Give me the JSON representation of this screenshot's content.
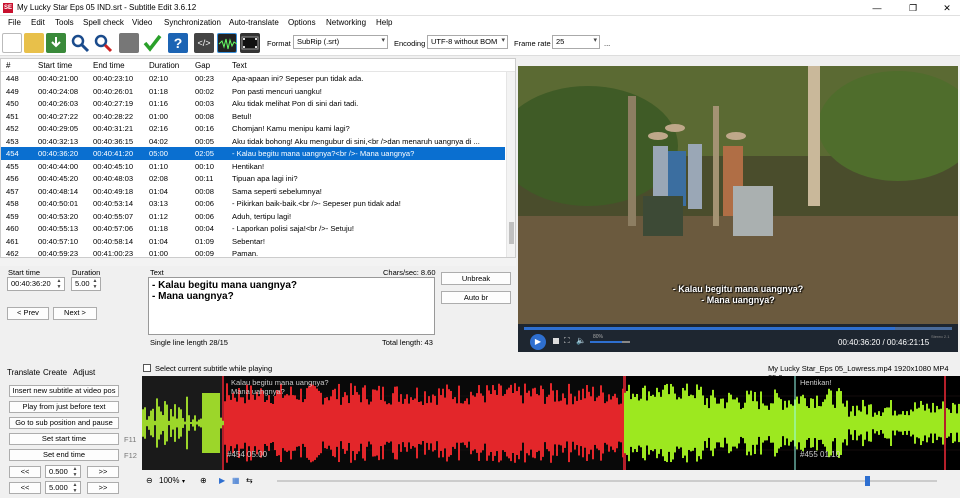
{
  "window": {
    "title": "My Lucky Star Eps 05 IND.srt - Subtitle Edit 3.6.12",
    "app_icon_text": "SE",
    "minimize": "—",
    "maximize": "❐",
    "close": "✕"
  },
  "menu": [
    "File",
    "Edit",
    "Tools",
    "Spell check",
    "Video",
    "Synchronization",
    "Auto-translate",
    "Options",
    "Networking",
    "Help"
  ],
  "toolbar": {
    "format_label": "Format",
    "format_value": "SubRip (.srt)",
    "encoding_label": "Encoding",
    "encoding_value": "UTF-8 without BOM",
    "framerate_label": "Frame rate",
    "framerate_value": "25",
    "more": "..."
  },
  "table": {
    "columns": [
      "#",
      "Start time",
      "End time",
      "Duration",
      "Gap",
      "Text"
    ],
    "rows": [
      [
        "448",
        "00:40:21:00",
        "00:40:23:10",
        "02:10",
        "00:23",
        "Apa-apaan ini? Sepeser pun tidak ada."
      ],
      [
        "449",
        "00:40:24:08",
        "00:40:26:01",
        "01:18",
        "00:02",
        "Pon pasti mencuri uangku!"
      ],
      [
        "450",
        "00:40:26:03",
        "00:40:27:19",
        "01:16",
        "00:03",
        "Aku tidak melihat Pon di sini dari tadi."
      ],
      [
        "451",
        "00:40:27:22",
        "00:40:28:22",
        "01:00",
        "00:08",
        "Betul!"
      ],
      [
        "452",
        "00:40:29:05",
        "00:40:31:21",
        "02:16",
        "00:16",
        "Chomjan! Kamu menipu kami lagi?"
      ],
      [
        "453",
        "00:40:32:13",
        "00:40:36:15",
        "04:02",
        "00:05",
        "Aku tidak bohong! Aku mengubur di sini,<br />dan menaruh uangnya di ..."
      ],
      [
        "454",
        "00:40:36:20",
        "00:40:41:20",
        "05:00",
        "02:05",
        "- Kalau begitu mana uangnya?<br />- Mana uangnya?"
      ],
      [
        "455",
        "00:40:44:00",
        "00:40:45:10",
        "01:10",
        "00:10",
        "Hentikan!"
      ],
      [
        "456",
        "00:40:45:20",
        "00:40:48:03",
        "02:08",
        "00:11",
        "Tipuan apa lagi ini?"
      ],
      [
        "457",
        "00:40:48:14",
        "00:40:49:18",
        "01:04",
        "00:08",
        "Sama seperti sebelumnya!"
      ],
      [
        "458",
        "00:40:50:01",
        "00:40:53:14",
        "03:13",
        "00:06",
        "- Pikirkan baik-baik.<br />- Sepeser pun tidak ada!"
      ],
      [
        "459",
        "00:40:53:20",
        "00:40:55:07",
        "01:12",
        "00:06",
        "Aduh, tertipu lagi!"
      ],
      [
        "460",
        "00:40:55:13",
        "00:40:57:06",
        "01:18",
        "00:04",
        "- Laporkan polisi saja!<br />- Setuju!"
      ],
      [
        "461",
        "00:40:57:10",
        "00:40:58:14",
        "01:04",
        "01:09",
        "Sebentar!"
      ],
      [
        "462",
        "00:40:59:23",
        "00:41:00:23",
        "01:00",
        "00:09",
        "Paman."
      ]
    ]
  },
  "editor": {
    "start_label": "Start time",
    "start_value": "00:40:36:20",
    "duration_label": "Duration",
    "duration_value": "5.00",
    "text_label": "Text",
    "chars_sec": "Chars/sec: 8.60",
    "text_line1": "- Kalau begitu mana uangnya?",
    "text_line2": "- Mana uangnya?",
    "single_line_length": "Single line length 28/15",
    "total_length": "Total length: 43",
    "prev": "< Prev",
    "next": "Next >",
    "unbreak": "Unbreak",
    "auto_br": "Auto br"
  },
  "video": {
    "subtitle1": "- Kalau begitu mana uangnya?",
    "subtitle2": "- Mana uangnya?",
    "time": "00:40:36:20 / 00:46:21:15",
    "volume_label": "80%",
    "brand": "Stereo 2.1"
  },
  "tabs": [
    "Translate",
    "Create",
    "Adjust"
  ],
  "create": {
    "insert": "Insert new subtitle at video pos",
    "play_before": "Play from just before text",
    "goto": "Go to sub position and pause",
    "set_start": "Set start time",
    "set_end": "Set end time",
    "f11": "F11",
    "f12": "F12",
    "back": "<<",
    "forward": ">>",
    "step1": "0.500",
    "step2": "5.000"
  },
  "waveform": {
    "checkbox_label": "Select current subtitle while playing",
    "file_info": "My Lucky Star_Eps 05_Lowress.mp4 1920x1080 MP4 25.0",
    "seg1_line1": "Kalau begitu mana uangnya?",
    "seg1_line2": "Mana uangnya?",
    "seg1_label": "#454  05:00",
    "seg2_text": "Hentikan!",
    "seg2_label": "#455  01:10",
    "zoom": "100%"
  }
}
